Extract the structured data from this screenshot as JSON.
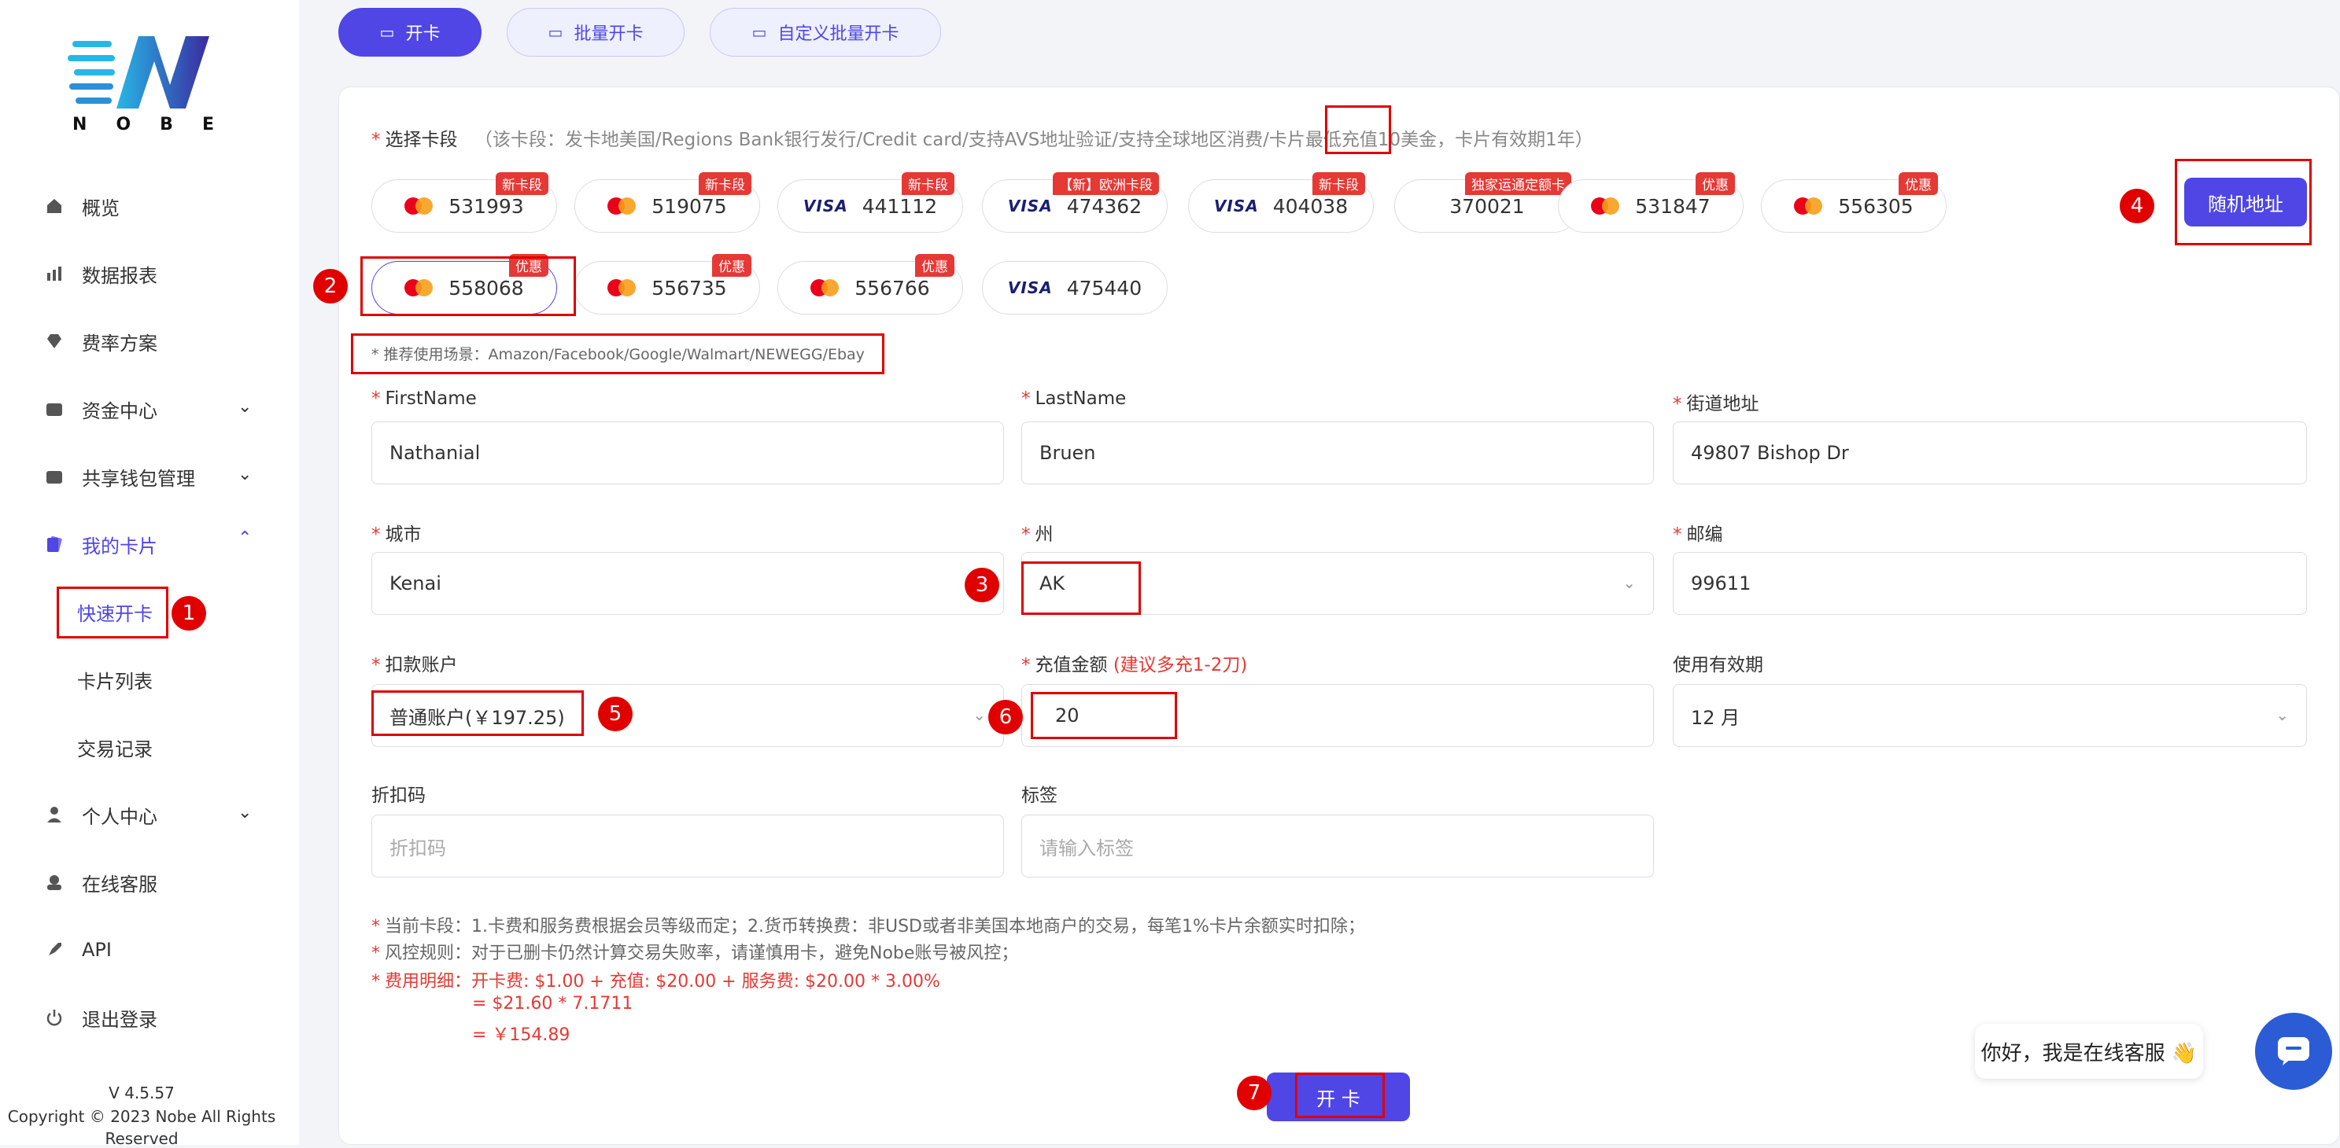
{
  "brand": {
    "logo_text": [
      "N",
      "O",
      "B",
      "E"
    ],
    "accent": "#4f46e5",
    "danger": "#e53935"
  },
  "sidebar": {
    "items": [
      {
        "label": "概览",
        "icon": "home-icon"
      },
      {
        "label": "数据报表",
        "icon": "chart-icon"
      },
      {
        "label": "费率方案",
        "icon": "diamond-icon"
      },
      {
        "label": "资金中心",
        "icon": "wallet-icon",
        "expandable": true
      },
      {
        "label": "共享钱包管理",
        "icon": "wallet-icon",
        "expandable": true
      },
      {
        "label": "我的卡片",
        "icon": "cards-icon",
        "expandable": true,
        "expanded": true
      },
      {
        "label": "个人中心",
        "icon": "user-icon",
        "expandable": true
      },
      {
        "label": "在线客服",
        "icon": "support-icon"
      },
      {
        "label": "API",
        "icon": "rocket-icon"
      },
      {
        "label": "退出登录",
        "icon": "power-icon"
      }
    ],
    "sub_items": [
      "快速开卡",
      "卡片列表",
      "交易记录"
    ],
    "version": "V 4.5.57",
    "copyright": "Copyright © 2023 Nobe All Rights",
    "copyright2": "Reserved"
  },
  "tabs": [
    {
      "label": "开卡"
    },
    {
      "label": "批量开卡"
    },
    {
      "label": "自定义批量开卡"
    }
  ],
  "form": {
    "card_segment_label": "选择卡段",
    "card_segment_hint": "（该卡段：发卡地美国/Regions Bank银行发行/Credit card/支持AVS地址验证/支持全球地区消费/卡片最低充值10美金，卡片有效期1年）",
    "cards_row1": [
      {
        "bin": "531993",
        "brand": "mc",
        "badge": "新卡段"
      },
      {
        "bin": "519075",
        "brand": "mc",
        "badge": "新卡段"
      },
      {
        "bin": "441112",
        "brand": "visa",
        "badge": "新卡段"
      },
      {
        "bin": "474362",
        "brand": "visa",
        "badge": "【新】欧洲卡段"
      },
      {
        "bin": "404038",
        "brand": "visa",
        "badge": "新卡段"
      },
      {
        "bin": "370021",
        "brand": "none",
        "badge": "独家运通定额卡"
      },
      {
        "bin": "531847",
        "brand": "mc",
        "badge": "优惠"
      },
      {
        "bin": "556305",
        "brand": "mc",
        "badge": "优惠"
      }
    ],
    "cards_row2": [
      {
        "bin": "558068",
        "brand": "mc",
        "badge": "优惠"
      },
      {
        "bin": "556735",
        "brand": "mc",
        "badge": "优惠"
      },
      {
        "bin": "556766",
        "brand": "mc",
        "badge": "优惠"
      },
      {
        "bin": "475440",
        "brand": "visa",
        "badge": ""
      }
    ],
    "visa_text": "VISA",
    "random_address_label": "随机地址",
    "scenario": "* 推荐使用场景：Amazon/Facebook/Google/Walmart/NEWEGG/Ebay",
    "firstname_label": "FirstName",
    "firstname_value": "Nathanial",
    "lastname_label": "LastName",
    "lastname_value": "Bruen",
    "street_label": "街道地址",
    "street_value": "49807 Bishop Dr",
    "city_label": "城市",
    "city_value": "Kenai",
    "state_label": "州",
    "state_value": "AK",
    "zip_label": "邮编",
    "zip_value": "99611",
    "account_label": "扣款账户",
    "account_value": "普通账户(￥197.25)",
    "amount_label": "充值金额",
    "amount_hint": "(建议多充1-2刀)",
    "amount_value": "20",
    "validity_label": "使用有效期",
    "validity_value": "12 月",
    "discount_label": "折扣码",
    "discount_placeholder": "折扣码",
    "tag_label": "标签",
    "tag_placeholder": "请输入标签",
    "note1": "当前卡段：1.卡费和服务费根据会员等级而定；2.货币转换费：非USD或者非美国本地商户的交易，每笔1%卡片余额实时扣除；",
    "note2": "风控规则：对于已删卡仍然计算交易失败率，请谨慎用卡，避免Nobe账号被风控；",
    "note3": "费用明细：开卡费: $1.00 + 充值: $20.00 + 服务费: $20.00 * 3.00%",
    "note4": "= $21.60 * 7.1711",
    "note5": "= ￥154.89",
    "submit_label": "开 卡"
  },
  "annotations": [
    "1",
    "2",
    "3",
    "4",
    "5",
    "6",
    "7"
  ],
  "chat": {
    "greeting": "你好，我是在线客服 👋"
  }
}
